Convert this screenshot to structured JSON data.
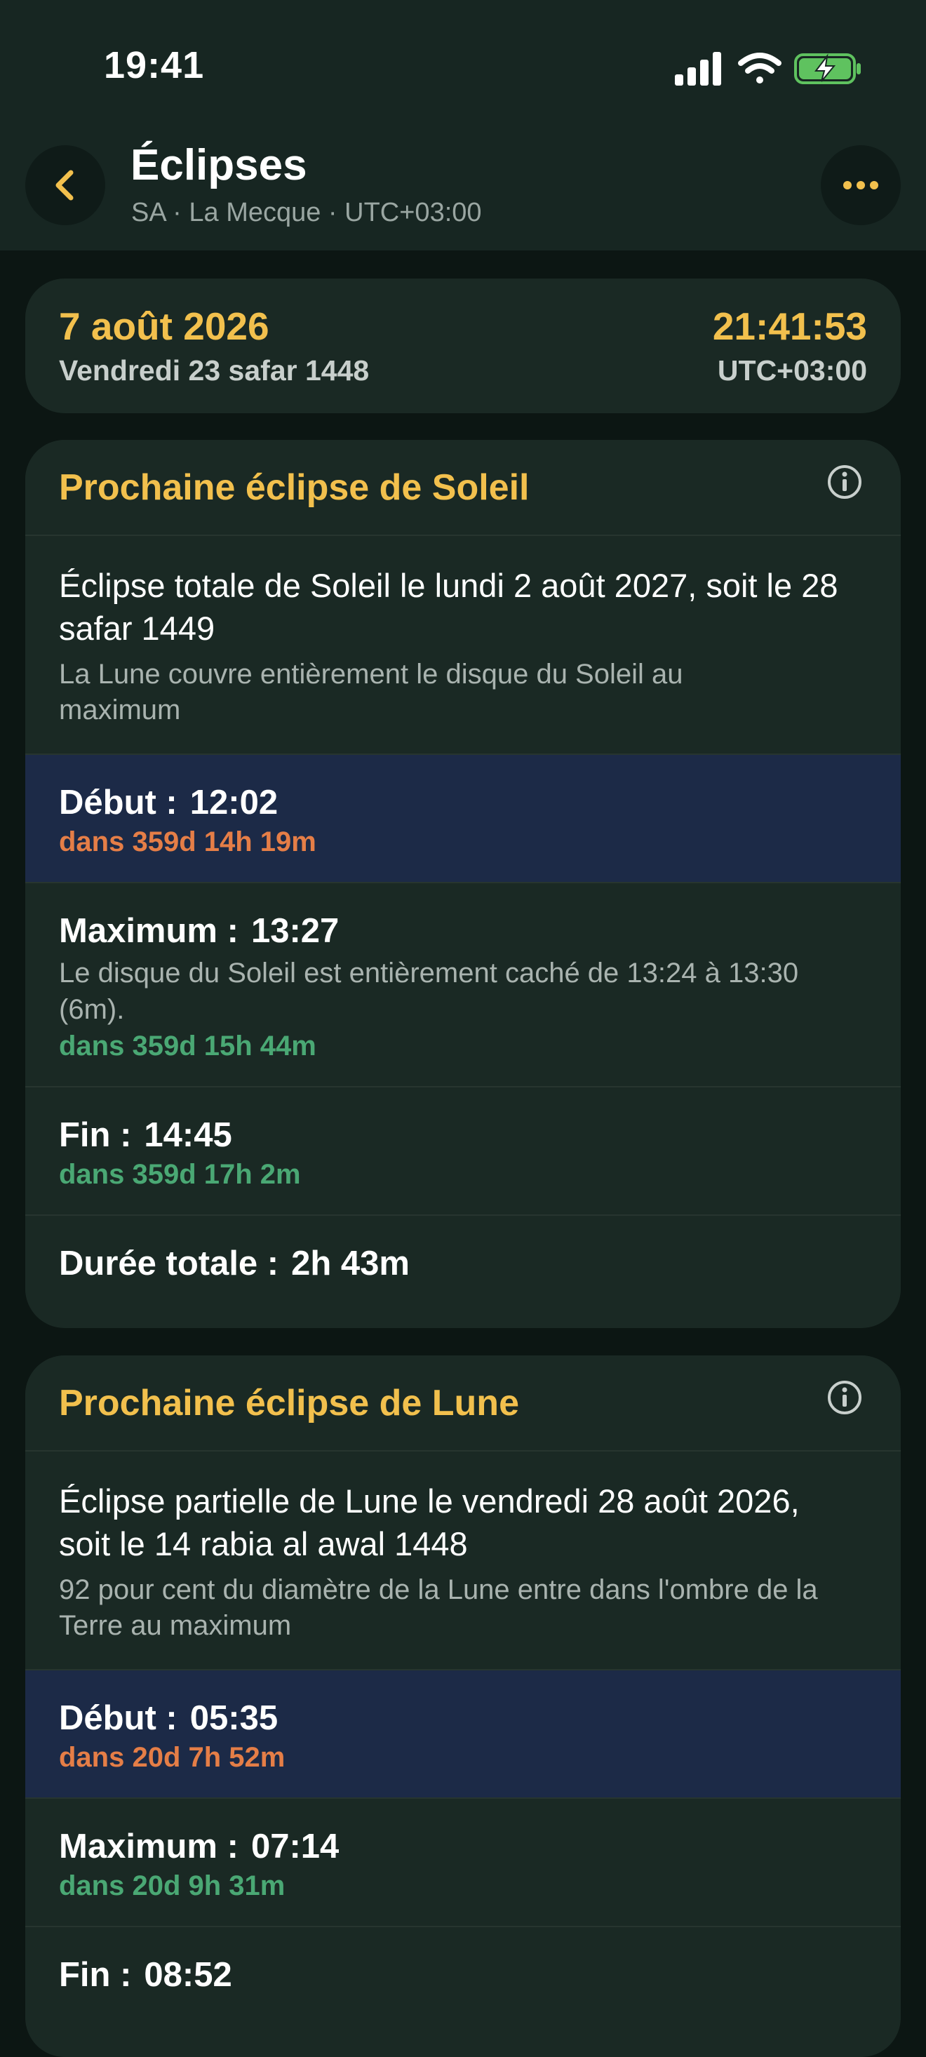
{
  "status": {
    "time": "19:41"
  },
  "header": {
    "title": "Éclipses",
    "subtitle": "SA · La Mecque · UTC+03:00"
  },
  "current": {
    "date": "7 août 2026",
    "hijri": "Vendredi 23 safar 1448",
    "time": "21:41:53",
    "tz": "UTC+03:00"
  },
  "sun": {
    "title": "Prochaine éclipse de Soleil",
    "desc": "Éclipse totale de Soleil le lundi 2 août 2027, soit le 28 safar 1449",
    "desc_sub": "La Lune couvre entièrement le disque du Soleil au maximum",
    "begin": {
      "label": "Début :",
      "value": "12:02",
      "countdown": "dans 359d 14h 19m"
    },
    "max": {
      "label": "Maximum :",
      "value": "13:27",
      "note": "Le disque du Soleil est entièrement caché de 13:24 à 13:30 (6m).",
      "countdown": "dans 359d 15h 44m"
    },
    "end": {
      "label": "Fin :",
      "value": "14:45",
      "countdown": "dans 359d 17h 2m"
    },
    "duration": {
      "label": "Durée totale :",
      "value": "2h 43m"
    }
  },
  "moon": {
    "title": "Prochaine éclipse de Lune",
    "desc": "Éclipse partielle de Lune le vendredi 28 août 2026, soit le 14 rabia al awal 1448",
    "desc_sub": "92 pour cent du diamètre de la Lune entre dans l'ombre de la Terre au maximum",
    "begin": {
      "label": "Début :",
      "value": "05:35",
      "countdown": "dans 20d 7h 52m"
    },
    "max": {
      "label": "Maximum :",
      "value": "07:14",
      "countdown": "dans 20d 9h 31m"
    },
    "end": {
      "label": "Fin :",
      "value": "08:52"
    }
  },
  "colors": {
    "accent": "#f2c04d",
    "countdown_current": "#e57e47",
    "countdown_future": "#4aa874",
    "highlight_row": "#1c2a47"
  },
  "icons": [
    "back-chevron-icon",
    "more-icon",
    "info-icon",
    "signal-icon",
    "wifi-icon",
    "battery-charging-icon"
  ]
}
